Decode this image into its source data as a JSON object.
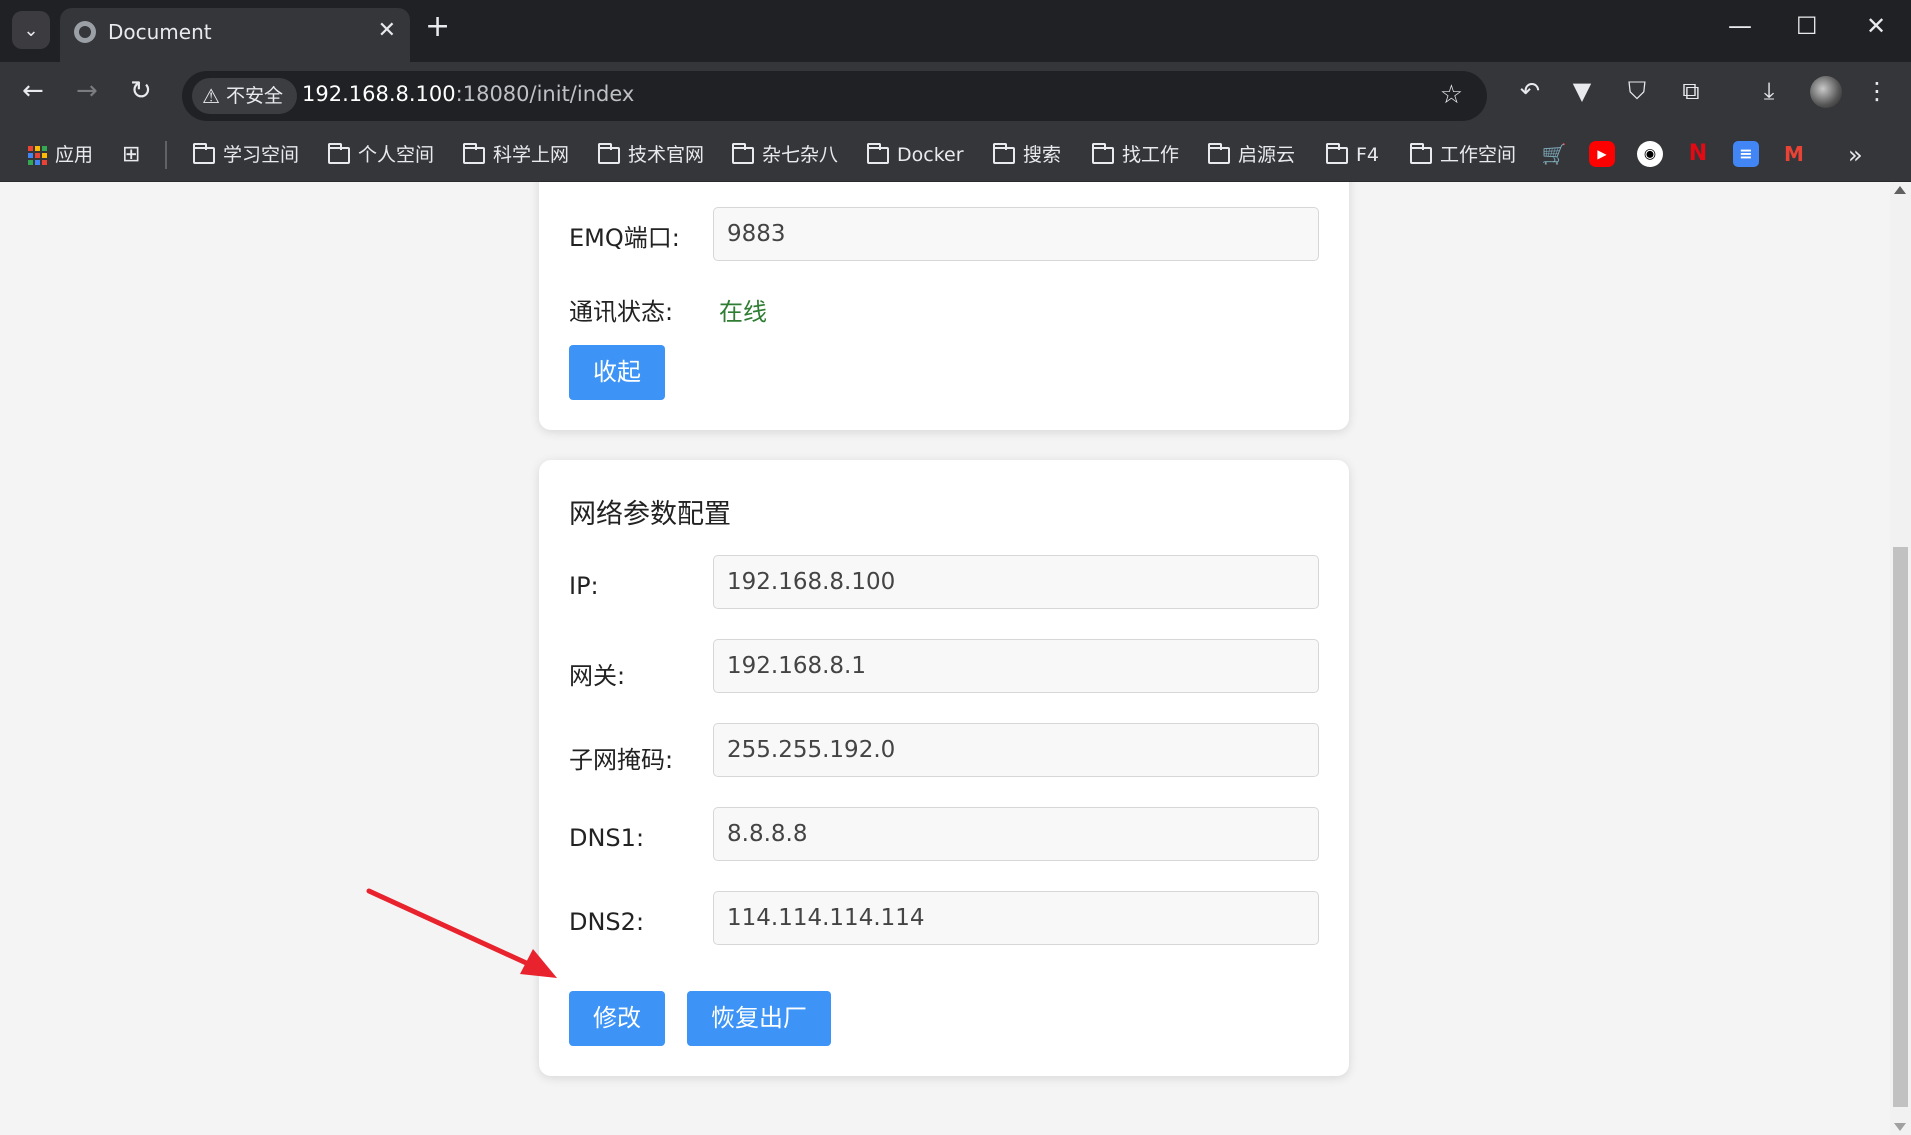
{
  "browser": {
    "tab_title": "Document",
    "tab_close": "✕",
    "new_tab": "+",
    "security_label": "不安全",
    "url_host": "192.168.8.100",
    "url_path": ":18080/init/index",
    "window_controls": {
      "minimize": "—",
      "maximize": "☐",
      "close": "✕"
    }
  },
  "bookmarks": {
    "apps_label": "应用",
    "folders": [
      "学习空间",
      "个人空间",
      "科学上网",
      "技术官网",
      "杂七杂八",
      "Docker",
      "搜索",
      "找工作",
      "启源云",
      "F4",
      "工作空间"
    ],
    "more": "»"
  },
  "emq_card": {
    "port_label": "EMQ端口:",
    "port_value": "9883",
    "status_label": "通讯状态:",
    "status_value": "在线",
    "collapse_button": "收起"
  },
  "network_card": {
    "title": "网络参数配置",
    "fields": [
      {
        "label": "IP:",
        "value": "192.168.8.100"
      },
      {
        "label": "网关:",
        "value": "192.168.8.1"
      },
      {
        "label": "子网掩码:",
        "value": "255.255.192.0"
      },
      {
        "label": "DNS1:",
        "value": "8.8.8.8"
      },
      {
        "label": "DNS2:",
        "value": "114.114.114.114"
      }
    ],
    "modify_button": "修改",
    "reset_button": "恢复出厂"
  },
  "colors": {
    "button": "#3d94f6",
    "status_online": "#2e7d32",
    "annotation_arrow": "#e8232d"
  }
}
